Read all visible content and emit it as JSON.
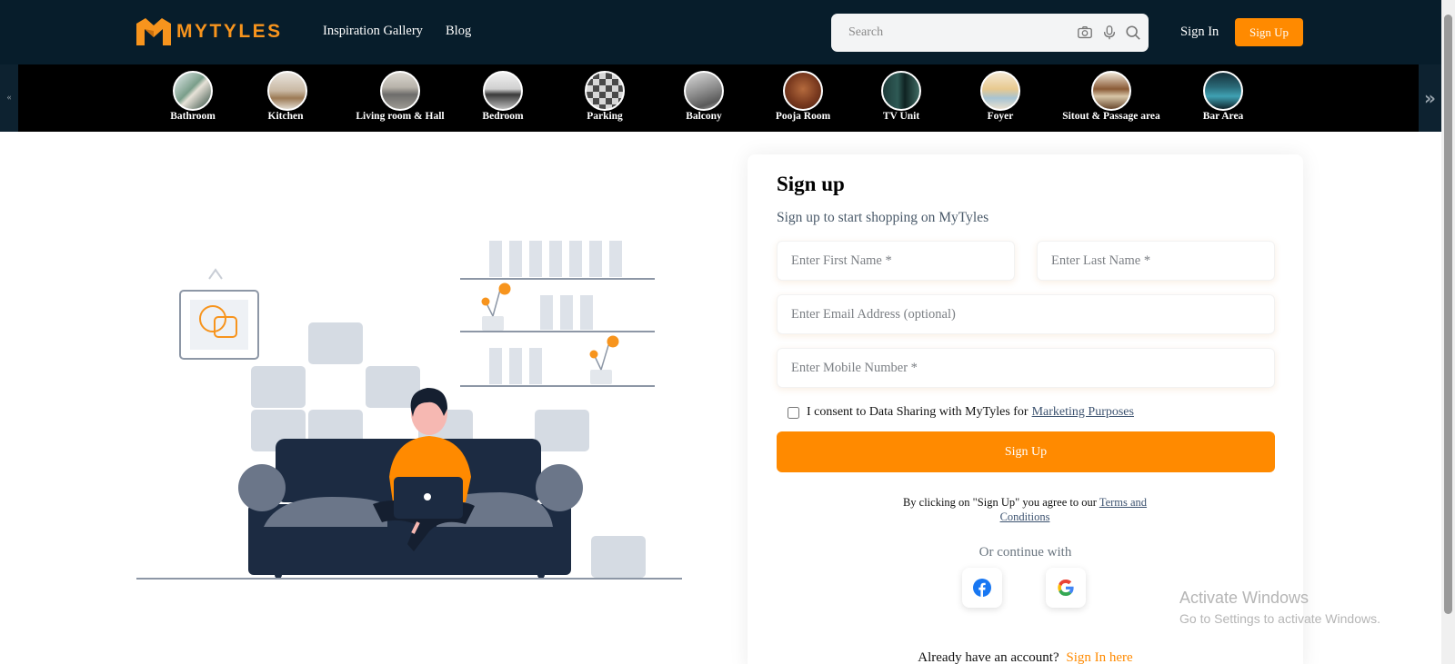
{
  "header": {
    "logo_text": "MYTYLES",
    "nav": [
      "Inspiration Gallery",
      "Blog"
    ],
    "search_placeholder": "Search",
    "signin_label": "Sign In",
    "signup_label": "Sign Up"
  },
  "categories": [
    {
      "label": "Bathroom",
      "icon": "bathroom-thumb"
    },
    {
      "label": "Kitchen",
      "icon": "kitchen-thumb"
    },
    {
      "label": "Living room & Hall",
      "icon": "living-room-thumb"
    },
    {
      "label": "Bedroom",
      "icon": "bedroom-thumb"
    },
    {
      "label": "Parking",
      "icon": "parking-thumb"
    },
    {
      "label": "Balcony",
      "icon": "balcony-thumb"
    },
    {
      "label": "Pooja Room",
      "icon": "pooja-room-thumb"
    },
    {
      "label": "TV Unit",
      "icon": "tv-unit-thumb"
    },
    {
      "label": "Foyer",
      "icon": "foyer-thumb"
    },
    {
      "label": "Sitout & Passage area",
      "icon": "sitout-thumb"
    },
    {
      "label": "Bar Area",
      "icon": "bar-area-thumb"
    }
  ],
  "carousel": {
    "prev": "«",
    "next": "»"
  },
  "form": {
    "title": "Sign up",
    "subtitle": "Sign up to start shopping on MyTyles",
    "first_name_placeholder": "Enter First Name *",
    "last_name_placeholder": "Enter Last Name *",
    "email_placeholder": "Enter Email Address (optional)",
    "mobile_placeholder": "Enter Mobile Number *",
    "consent_text": "I consent to Data Sharing with MyTyles for",
    "consent_link": "Marketing Purposes",
    "consent_checked": false,
    "submit_label": "Sign Up",
    "terms_text": "By clicking on \"Sign Up\" you agree to our",
    "terms_link": "Terms and Conditions",
    "or_continue": "Or continue with",
    "already_text": "Already have an account?",
    "signin_link": "Sign In here"
  },
  "watermark": {
    "title": "Activate Windows",
    "subtitle": "Go to Settings to activate Windows."
  },
  "colors": {
    "navbar_bg": "#071d2b",
    "accent": "#ff8a00",
    "category_bg": "#000000",
    "link": "#3d5370"
  }
}
